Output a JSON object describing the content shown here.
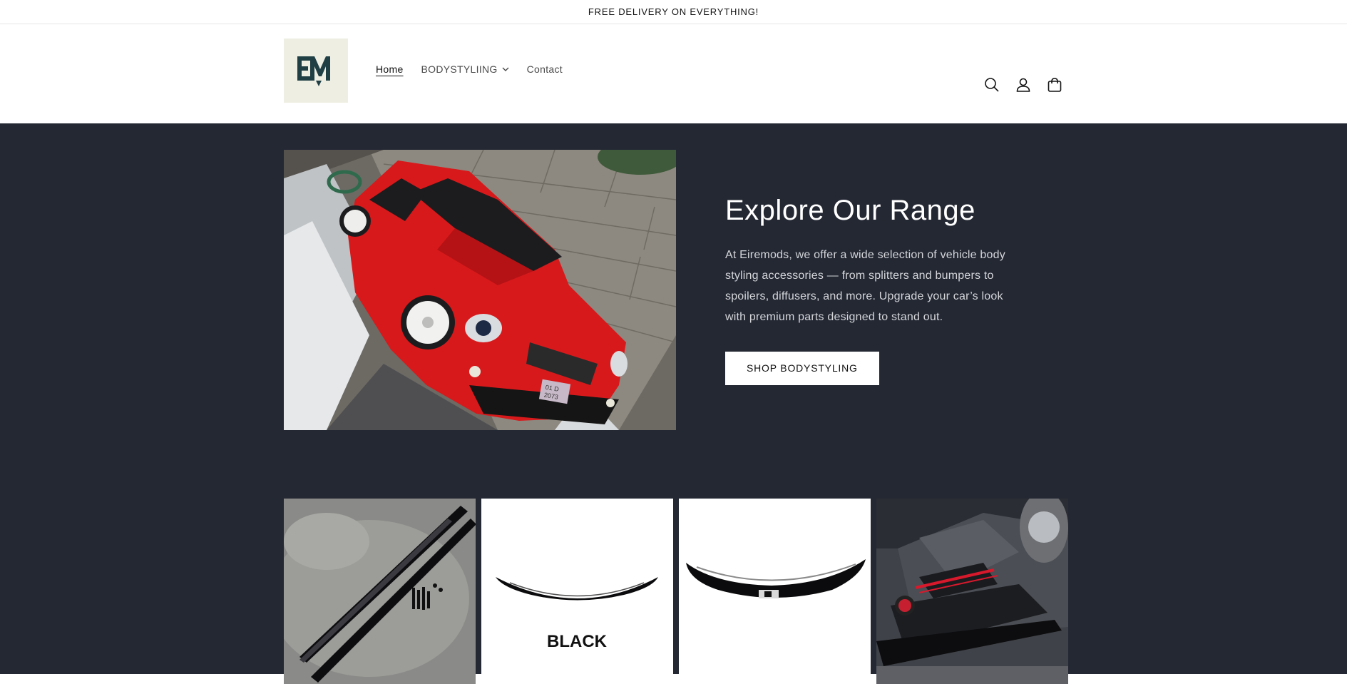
{
  "announcement": {
    "text": "FREE DELIVERY ON EVERYTHING!"
  },
  "header": {
    "logo_text": "EM",
    "nav": [
      {
        "label": "Home",
        "active": true
      },
      {
        "label": "BODYSTYLIING",
        "has_dropdown": true
      },
      {
        "label": "Contact"
      }
    ],
    "icons": [
      "search-icon",
      "account-icon",
      "cart-icon"
    ]
  },
  "hero": {
    "title": "Explore Our Range",
    "body": "At Eiremods, we offer a wide selection of vehicle body styling accessories — from splitters and bumpers to spoilers, diffusers, and more. Upgrade your car’s look with premium parts designed to stand out.",
    "button_label": "SHOP BODYSTYLING",
    "plate_text_1": "01 D",
    "plate_text_2": "2073"
  },
  "products": [
    {
      "image": "side-skirts"
    },
    {
      "image": "spoiler-black",
      "caption": "BLACK"
    },
    {
      "image": "spoiler-gloss"
    },
    {
      "image": "car-front-splitter"
    }
  ],
  "colors": {
    "hero_bg": "#242833",
    "logo_bg": "#efeee3",
    "logo_fg": "#1f3f44",
    "car_red": "#d8191b"
  }
}
